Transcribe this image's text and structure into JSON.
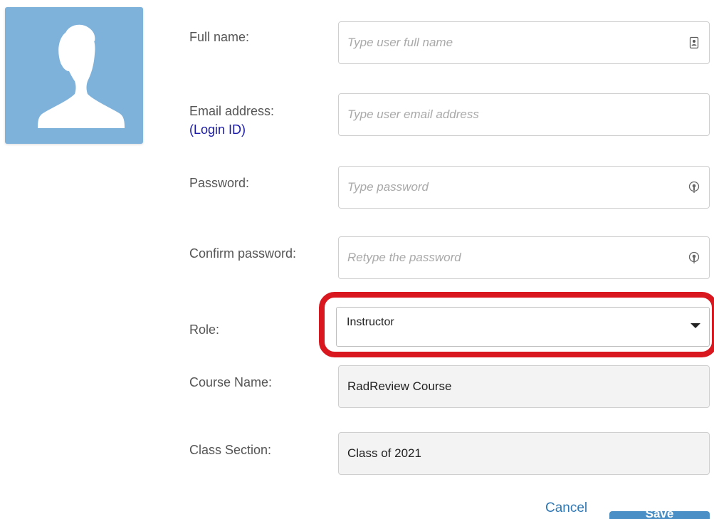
{
  "colors": {
    "avatar_bg": "#7fb2da",
    "highlight": "#d8171f",
    "link": "#2f78b5",
    "save_bg": "#4a90c6",
    "login_id": "#1a1aa6"
  },
  "form": {
    "full_name": {
      "label": "Full name:",
      "placeholder": "Type user full name",
      "icon": "contact-card-icon"
    },
    "email": {
      "label": "Email address:",
      "sublabel": "(Login ID)",
      "placeholder": "Type user email address"
    },
    "password": {
      "label": "Password:",
      "placeholder": "Type password",
      "icon": "password-key-icon"
    },
    "confirm_password": {
      "label": "Confirm password:",
      "placeholder": "Retype the password",
      "icon": "password-key-icon"
    },
    "role": {
      "label": "Role:",
      "value": "Instructor"
    },
    "course_name": {
      "label": "Course Name:",
      "value": "RadReview Course"
    },
    "class_section": {
      "label": "Class Section:",
      "value": "Class of 2021"
    }
  },
  "actions": {
    "cancel_label": "Cancel",
    "save_label": "Save"
  }
}
